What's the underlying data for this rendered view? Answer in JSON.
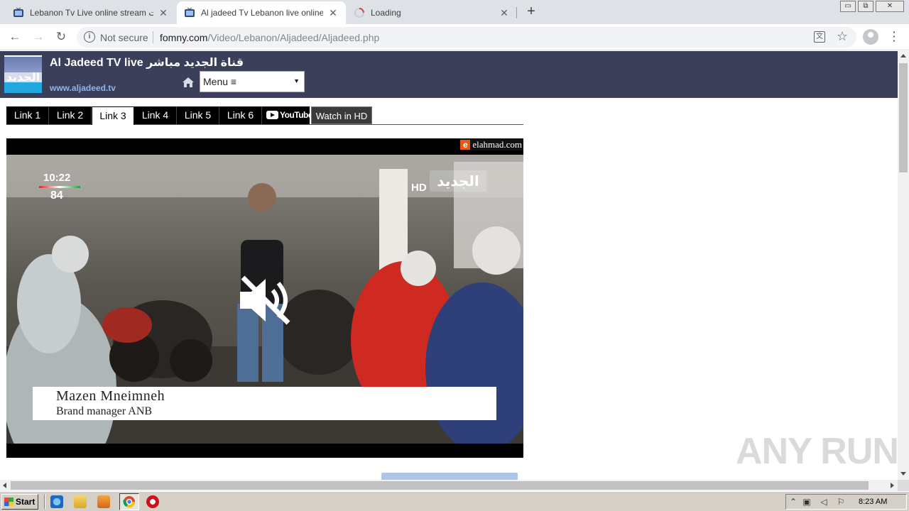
{
  "browser": {
    "tabs": [
      {
        "title": "Lebanon Tv Live online stream قنوات",
        "active": false
      },
      {
        "title": "Al jadeed Tv Lebanon live online stream",
        "active": true
      },
      {
        "title": "Loading",
        "active": false
      }
    ],
    "new_tab": "+",
    "window_buttons": {
      "minimize": "▭",
      "restore": "⧉",
      "close": "✕"
    },
    "nav": {
      "back": "←",
      "forward": "→",
      "reload": "↻"
    },
    "security_label": "Not secure",
    "url_host": "fomny.com",
    "url_path": "/Video/Lebanon/Aljadeed/Aljadeed.php",
    "translate_icon": "文",
    "bookmark_icon": "☆",
    "menu_icon": "⋮"
  },
  "site": {
    "logo_text": "الجديد",
    "title": "Al Jadeed TV live قناة الجديد مباشر",
    "url": "www.aljadeed.tv",
    "menu_label": "Menu ≡",
    "menu_arrow": "▼"
  },
  "links": [
    "Link 1",
    "Link 2",
    "Link 3",
    "Link 4",
    "Link 5",
    "Link 6"
  ],
  "active_link": "Link 3",
  "youtube_label": "YouTube",
  "watch_hd_label": "Watch in HD",
  "player": {
    "source_badge": "e",
    "source_domain": "elahmad.com",
    "clock": "10:22",
    "temperature": "84",
    "channel_hd": "HD",
    "channel_logo": "الجديد",
    "lower_third_name": "Mazen Mneimneh",
    "lower_third_role": "Brand manager ANB",
    "muted": true
  },
  "watermark": "ANY RUN",
  "taskbar": {
    "start_label": "Start",
    "time": "8:23 AM",
    "quicklaunch": [
      "internet-explorer",
      "folder",
      "media-player",
      "chrome",
      "opera"
    ]
  },
  "colors": {
    "site_header": "#3c3f59",
    "link_bg": "#000000",
    "site_url": "#8fb4ea",
    "badge_orange": "#e65b12"
  }
}
